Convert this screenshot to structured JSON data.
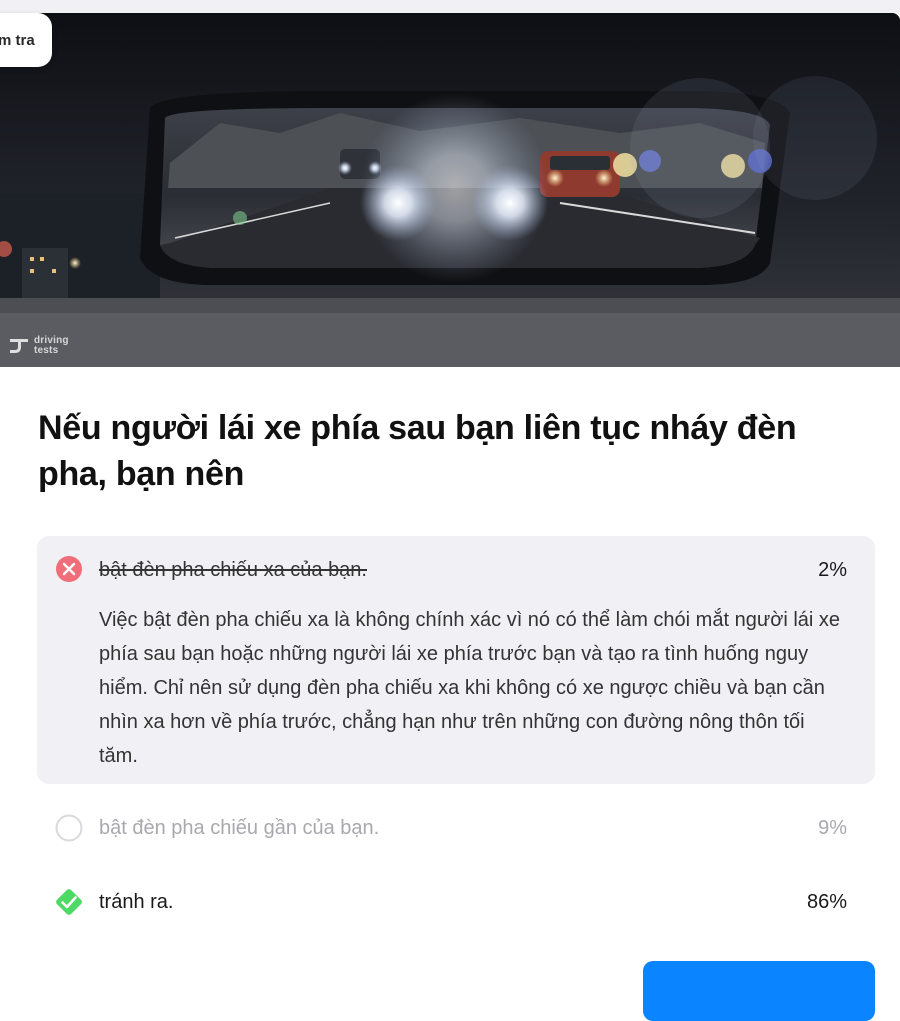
{
  "badge": {
    "label": "m tra"
  },
  "hero": {
    "image": "rearview-mirror-headlight-glare",
    "watermark": {
      "line1": "driving",
      "line2": "tests"
    }
  },
  "question": {
    "text": "Nếu người lái xe phía sau bạn liên tục nháy đèn pha, bạn nên"
  },
  "answers": [
    {
      "text": "bật đèn pha chiếu xa của bạn.",
      "percent": "2%",
      "state": "selected-wrong",
      "icon": "x-circle-icon",
      "explanation": "Việc bật đèn pha chiếu xa là không chính xác vì nó có thể làm chói mắt người lái xe phía sau bạn hoặc những người lái xe phía trước bạn và tạo ra tình huống nguy hiểm. Chỉ nên sử dụng đèn pha chiếu xa khi không có xe ngược chiều và bạn cần nhìn xa hơn về phía trước, chẳng hạn như trên những con đường nông thôn tối tăm."
    },
    {
      "text": "bật đèn pha chiếu gần của bạn.",
      "percent": "9%",
      "state": "unselected",
      "icon": "empty-circle-icon"
    },
    {
      "text": "tránh ra.",
      "percent": "86%",
      "state": "correct",
      "icon": "check-diamond-icon"
    }
  ],
  "colors": {
    "wrong": "#f06e7a",
    "correct": "#4cd964",
    "accent": "#0a84ff",
    "panel": "#f1f1f5"
  }
}
